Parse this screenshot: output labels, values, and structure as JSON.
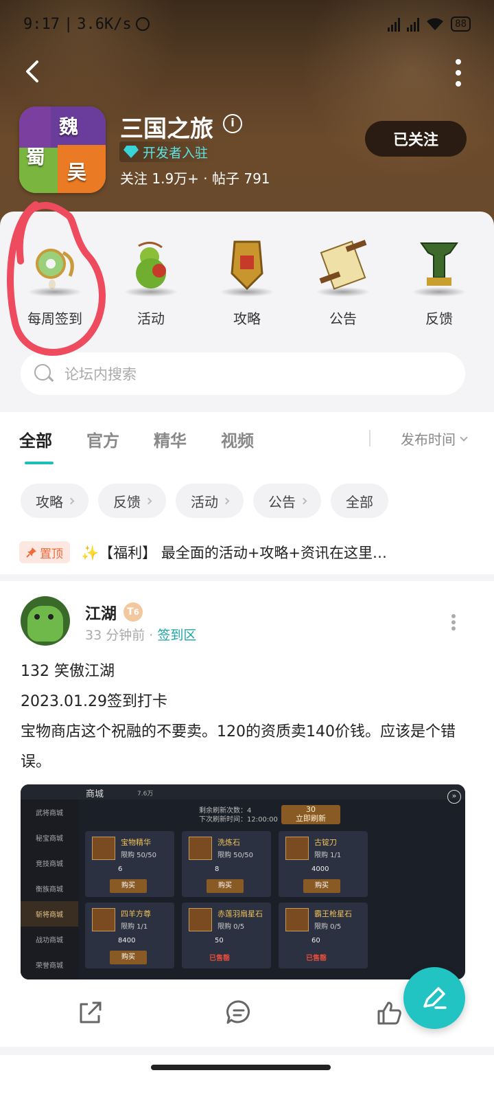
{
  "status_bar": {
    "time": "9:17",
    "net_speed": "3.6K/s",
    "battery": "88"
  },
  "header": {
    "app_title": "三国之旅",
    "icon_chars": [
      "魏",
      "蜀",
      "吴"
    ],
    "dev_badge": "开发者入驻",
    "stats": "关注 1.9万+ · 帖子 791",
    "follow_label": "已关注"
  },
  "shortcuts": [
    {
      "label": "每周签到",
      "icon": "jade-pendant-icon"
    },
    {
      "label": "活动",
      "icon": "gourd-icon"
    },
    {
      "label": "攻略",
      "icon": "badge-icon"
    },
    {
      "label": "公告",
      "icon": "scroll-icon"
    },
    {
      "label": "反馈",
      "icon": "cauldron-icon"
    }
  ],
  "search": {
    "placeholder": "论坛内搜索"
  },
  "tabs": [
    "全部",
    "官方",
    "精华",
    "视频"
  ],
  "sort_label": "发布时间",
  "chips": [
    "攻略",
    "反馈",
    "活动",
    "公告",
    "全部"
  ],
  "pinned": {
    "badge": "置顶",
    "text": "✨【福利】 最全面的活动+攻略+资讯在这里…"
  },
  "post": {
    "user": "江湖",
    "level": "6",
    "time": "33 分钟前",
    "section": "签到区",
    "lines": [
      "132  笑傲江湖",
      "2023.01.29签到打卡",
      "宝物商店这个祝融的不要卖。120的资质卖140价钱。应该是个错误。"
    ],
    "shot": {
      "title": "商城",
      "coin": "7.6万",
      "side": [
        "武将商城",
        "秘宝商城",
        "竞技商城",
        "衡族商城",
        "斩将商城",
        "战功商城",
        "荣誉商城"
      ],
      "info_1": "剩余刷新次数：4",
      "info_2": "下次刷新时间：12:00:00",
      "refresh_cost": "30",
      "refresh_label": "立即刷新",
      "items": [
        {
          "name": "宝物精华",
          "limit": "限购 50/50",
          "price": "6",
          "state": "购买"
        },
        {
          "name": "洗炼石",
          "limit": "限购 50/50",
          "price": "8",
          "state": "购买"
        },
        {
          "name": "古锭刀",
          "limit": "限购 1/1",
          "price": "4000",
          "state": "购买"
        },
        {
          "name": "四羊方尊",
          "limit": "限购 1/1",
          "price": "8400",
          "state": "购买"
        },
        {
          "name": "赤莲羽扇星石",
          "limit": "限购 0/5",
          "price": "50",
          "state": "已售罄"
        },
        {
          "name": "霸王枪星石",
          "limit": "限购 0/5",
          "price": "60",
          "state": "已售罄"
        }
      ]
    }
  },
  "colors": {
    "accent": "#1dbdb8",
    "pin": "#f06a3a",
    "annotation": "#ef4b5f"
  }
}
